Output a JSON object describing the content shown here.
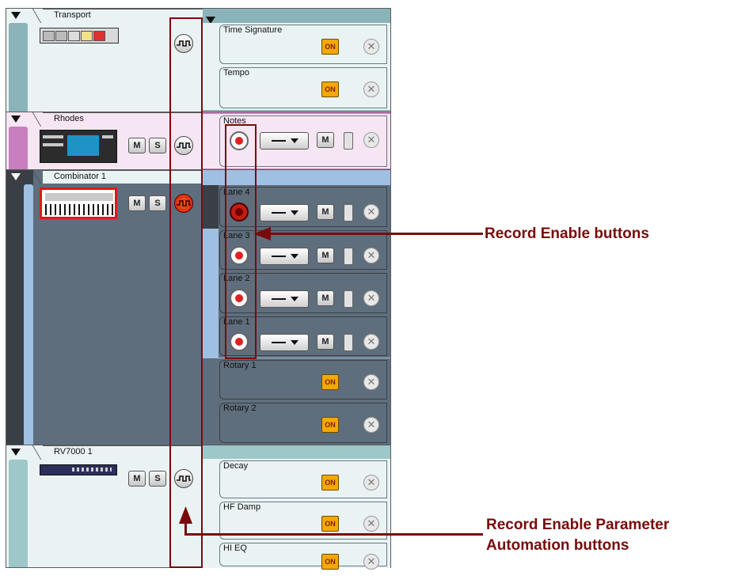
{
  "tracks": {
    "transport": {
      "name": "Transport",
      "lanes": [
        {
          "label": "Time Signature",
          "on": "ON"
        },
        {
          "label": "Tempo",
          "on": "ON"
        }
      ]
    },
    "rhodes": {
      "name": "Rhodes",
      "mute": "M",
      "solo": "S",
      "lanes": [
        {
          "label": "Notes",
          "mute": "M"
        }
      ]
    },
    "combinator": {
      "name": "Combinator 1",
      "mute": "M",
      "solo": "S",
      "note_lanes": [
        {
          "label": "Lane 4",
          "mute": "M"
        },
        {
          "label": "Lane 3",
          "mute": "M"
        },
        {
          "label": "Lane 2",
          "mute": "M"
        },
        {
          "label": "Lane 1",
          "mute": "M"
        }
      ],
      "param_lanes": [
        {
          "label": "Rotary 1",
          "on": "ON"
        },
        {
          "label": "Rotary 2",
          "on": "ON"
        }
      ]
    },
    "rv7000": {
      "name": "RV7000 1",
      "mute": "M",
      "solo": "S",
      "lanes": [
        {
          "label": "Decay",
          "on": "ON"
        },
        {
          "label": "HF Damp",
          "on": "ON"
        },
        {
          "label": "HI EQ",
          "on": "ON"
        }
      ]
    }
  },
  "annotations": {
    "record_enable": "Record Enable buttons",
    "param_automation_line1": "Record Enable Parameter",
    "param_automation_line2": "Automation buttons"
  },
  "icons": {
    "clear": "close-circle-icon",
    "automation": "automation-wave-icon",
    "collapse": "triangle-down-icon"
  },
  "colors": {
    "transport_strip": "#8ab4b9",
    "rhodes_strip": "#c77fc0",
    "combinator_bg": "#5f6e7d",
    "combinator_strip": "#9fc0e0",
    "rv_strip": "#9ec7c9",
    "annotation": "#7a0a0a",
    "on_button": "#f5a800",
    "record": "#e02020"
  }
}
